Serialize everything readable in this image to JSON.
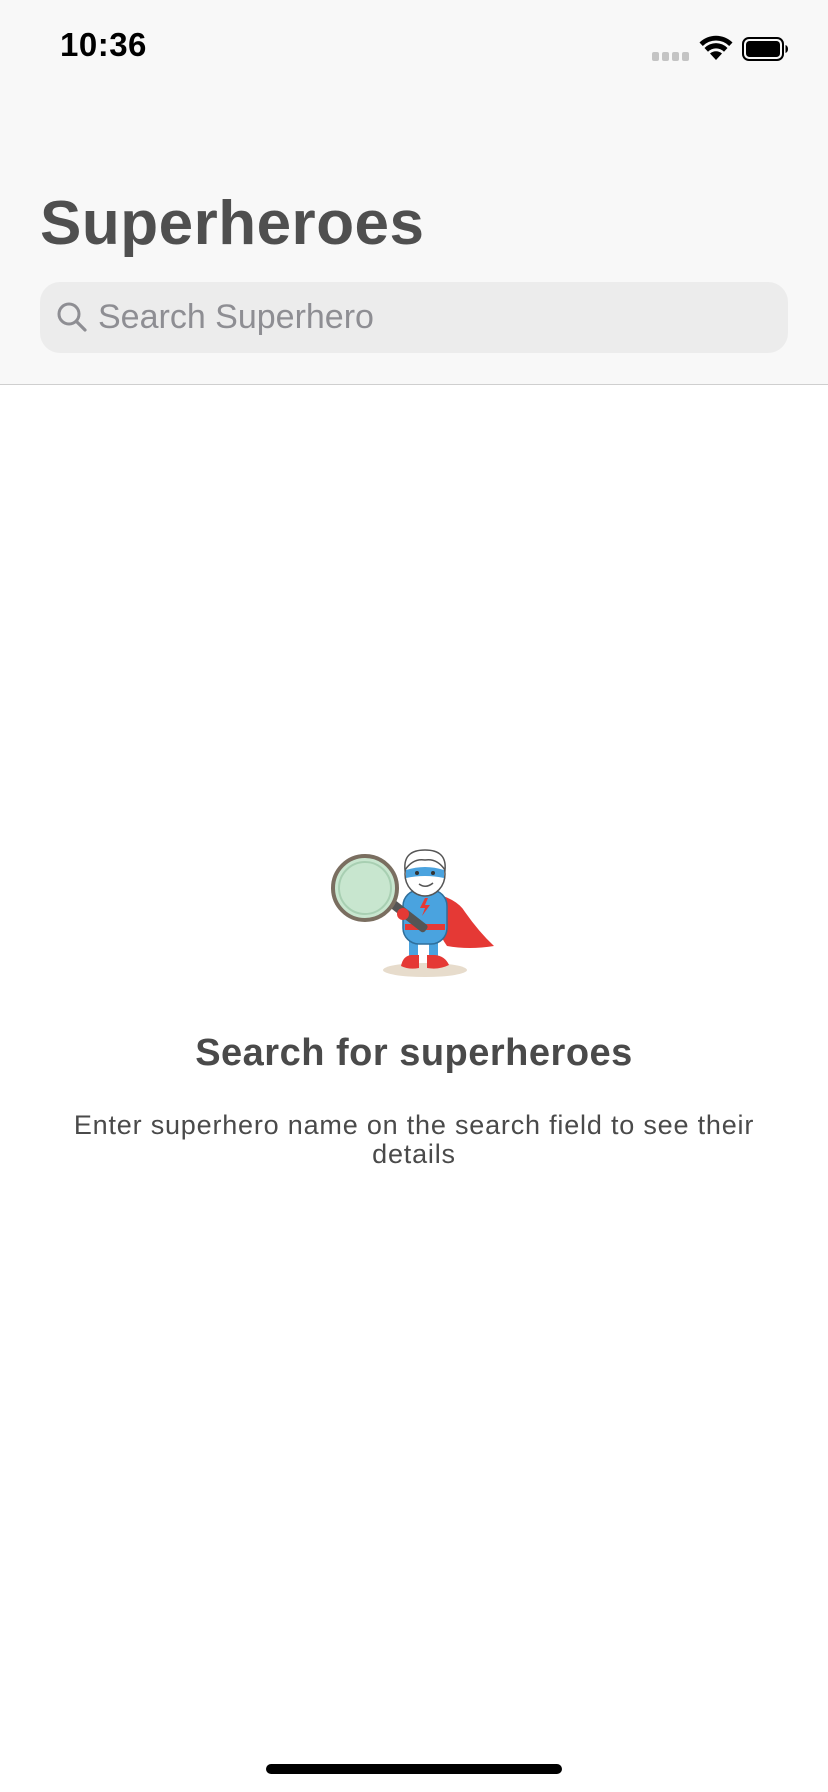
{
  "status_bar": {
    "time": "10:36"
  },
  "header": {
    "title": "Superheroes"
  },
  "search": {
    "placeholder": "Search Superhero",
    "value": ""
  },
  "empty_state": {
    "illustration": "superhero-magnifier-illustration",
    "title": "Search for superheroes",
    "subtitle": "Enter superhero name on the search field to see their details"
  },
  "colors": {
    "header_background": "#f8f8f8",
    "search_background": "#ececec",
    "title_text": "#4f4f4f",
    "placeholder_text": "#8e8e93",
    "hero_cape": "#e53935",
    "hero_suit": "#4aa3df",
    "lens": "#c8e6cf"
  },
  "icons": {
    "search": "magnifying-glass",
    "wifi": "wifi",
    "battery": "battery-full",
    "signal": "cellular-signal"
  }
}
